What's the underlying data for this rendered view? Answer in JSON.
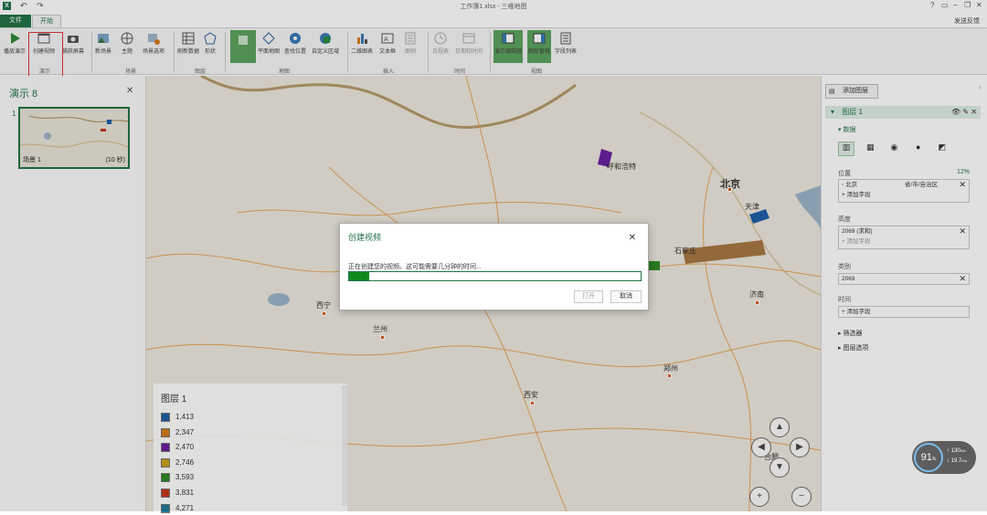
{
  "window": {
    "title": "工作簿1.xlsx - 三维地图",
    "app_icon": "X",
    "undo": "↶",
    "redo": "↷",
    "help": "?",
    "feedback": "发送反馈"
  },
  "tabs": [
    "文件",
    "开始"
  ],
  "ribbon": {
    "buttons": [
      {
        "label": "播放演示",
        "icon": "play-icon"
      },
      {
        "label": "创建视频",
        "icon": "video-icon"
      },
      {
        "label": "捕获屏幕",
        "icon": "camera-icon"
      },
      {
        "label": "新场景",
        "icon": "scene-icon"
      },
      {
        "label": "主题",
        "icon": "theme-icon"
      },
      {
        "label": "场景选项",
        "icon": "scene-options-icon"
      },
      {
        "label": "刷新数据",
        "icon": "refresh-icon"
      },
      {
        "label": "形状",
        "icon": "shape-icon"
      },
      {
        "label": "",
        "icon": "flat-map-placeholder-icon"
      },
      {
        "label": "平面地图",
        "icon": "flat-map-icon"
      },
      {
        "label": "查找位置",
        "icon": "find-location-icon"
      },
      {
        "label": "自定义区域",
        "icon": "custom-region-icon"
      },
      {
        "label": "二维图表",
        "icon": "chart-icon"
      },
      {
        "label": "文本框",
        "icon": "textbox-icon"
      },
      {
        "label": "图例",
        "icon": "legend-icon"
      },
      {
        "label": "日程表",
        "icon": "timeline-icon"
      },
      {
        "label": "日期和时间",
        "icon": "datetime-icon"
      },
      {
        "label": "演示编辑器",
        "icon": "tour-editor-icon"
      },
      {
        "label": "图层窗格",
        "icon": "layer-pane-icon"
      },
      {
        "label": "字段列表",
        "icon": "field-list-icon"
      }
    ],
    "groups": [
      "演示",
      "场景",
      "图层",
      "地图",
      "插入",
      "时间",
      "视图"
    ]
  },
  "left_pane": {
    "title": "演示 8",
    "slide_number": "1",
    "scene_label": "场景 1",
    "scene_duration": "(10 秒)"
  },
  "map": {
    "cities": [
      "呼和浩特",
      "北京",
      "天津",
      "石家庄",
      "西宁",
      "兰州",
      "济南",
      "郑州",
      "西安",
      "合肥"
    ],
    "legend": {
      "title": "图层 1",
      "items": [
        {
          "value": "1,413",
          "color": "#1f5fa8"
        },
        {
          "value": "2,347",
          "color": "#d77a1a"
        },
        {
          "value": "2,470",
          "color": "#6a1fa0"
        },
        {
          "value": "2,746",
          "color": "#c9a21c"
        },
        {
          "value": "3,593",
          "color": "#2e8a25"
        },
        {
          "value": "3,831",
          "color": "#c8371a"
        },
        {
          "value": "4,271",
          "color": "#1f7d9c"
        }
      ]
    }
  },
  "dialog": {
    "title": "创建视频",
    "message": "正在创建您的视频。这可能需要几分钟的时间...",
    "progress": 0.07,
    "open_label": "打开",
    "cancel_label": "取消"
  },
  "right_pane": {
    "add_layer": "添加图层",
    "layer_name": "图层 1",
    "data_section": "数据",
    "location_label": "位置",
    "location_pct": "12%",
    "location_field": "北京",
    "location_type": "省/市/自治区",
    "add_field": "添加字段",
    "height_label": "高度",
    "height_field": "2069 (求和)",
    "category_label": "类别",
    "category_field": "2069",
    "time_label": "时间",
    "filter_label": "筛选器",
    "layer_options": "图层选项"
  },
  "widget": {
    "value": "91",
    "unit": "%",
    "up": "130",
    "down": "19.7",
    "rate_unit": "K/s"
  },
  "colors": {
    "accent": "#217346",
    "progress": "#0f8a1c",
    "highlight": "#e03a3a"
  }
}
